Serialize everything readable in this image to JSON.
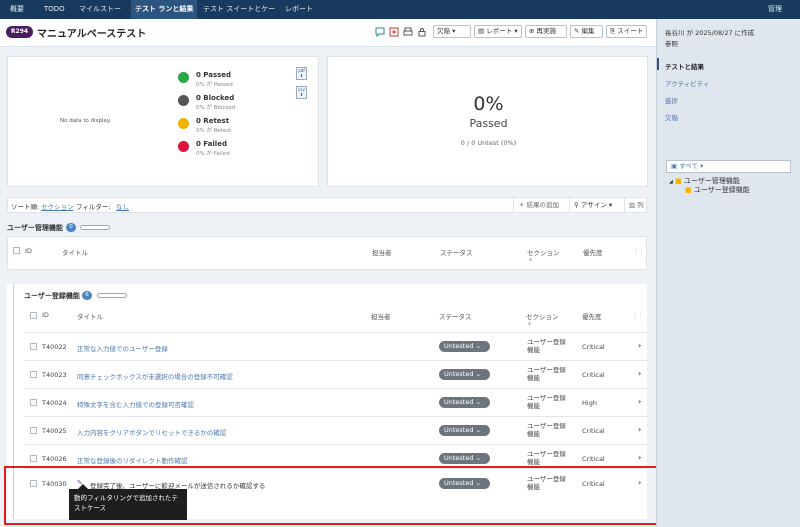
{
  "nav": {
    "tabs": [
      "概要",
      "TODO",
      "マイルストーン",
      "テスト ランと結果",
      "テスト スイートとケース",
      "レポート"
    ],
    "admin": "管理"
  },
  "header": {
    "badge": "R294",
    "title": "マニュアルベーステスト",
    "buttons": {
      "defects": "欠陥",
      "report": "レポート",
      "rerun": "再実施",
      "edit": "編集",
      "suite": "スイート"
    }
  },
  "summary": {
    "no_data": "No data to display.",
    "stats": [
      {
        "label": "0 Passed",
        "sub": "0% が Passed",
        "color": "#28a745"
      },
      {
        "label": "0 Blocked",
        "sub": "0% が Blocked",
        "color": "#555555"
      },
      {
        "label": "0 Retest",
        "sub": "0% が Retest",
        "color": "#f0b400"
      },
      {
        "label": "0 Failed",
        "sub": "0% が Failed",
        "color": "#dc143c"
      }
    ],
    "export_labels": [
      "pdf",
      "csv"
    ],
    "big_percent": "0%",
    "big_label": "Passed",
    "untest": "0 / 0 Untest (0%)"
  },
  "toolbar": {
    "sort_label": "ソート順:",
    "sort_value": "セクション",
    "filter_label": "フィルター:",
    "filter_value": "なし",
    "add_result": "結果の追加",
    "assign": "アサイン",
    "columns": "列"
  },
  "columns": {
    "id": "ID",
    "title": "タイトル",
    "assignee": "担当者",
    "status": "ステータス",
    "section": "セクション",
    "priority": "優先度"
  },
  "section1": {
    "name": "ユーザー管理機能",
    "count": "0"
  },
  "section2": {
    "name": "ユーザー登録機能",
    "count": "6",
    "rows": [
      {
        "id": "T40022",
        "title": "正常な入力値でのユーザー登録",
        "status": "Untested",
        "section": "ユーザー登録\n機能",
        "priority": "Critical"
      },
      {
        "id": "T40023",
        "title": "同意チェックボックスが未選択の場合の登録不可確認",
        "status": "Untested",
        "section": "ユーザー登録\n機能",
        "priority": "Critical"
      },
      {
        "id": "T40024",
        "title": "特殊文字を含む入力値での登録可否確認",
        "status": "Untested",
        "section": "ユーザー登録\n機能",
        "priority": "High"
      },
      {
        "id": "T40025",
        "title": "入力内容をクリアボタンでリセットできるかの確認",
        "status": "Untested",
        "section": "ユーザー登録\n機能",
        "priority": "Critical"
      },
      {
        "id": "T40026",
        "title": "正常な登録後のリダイレクト動作確認",
        "status": "Untested",
        "section": "ユーザー登録\n機能",
        "priority": "Critical"
      },
      {
        "id": "T40030",
        "title": "登録完了後、ユーザーに歓迎メールが送信されるか確認する",
        "status": "Untested",
        "section": "ユーザー登録\n機能",
        "priority": "Critical"
      }
    ]
  },
  "tooltip": "動的フィルタリングで追加されたテ\nストケース",
  "right_panel": {
    "created": "長谷川 が 2025/08/27 に作成",
    "ref": "参照",
    "links": [
      "テストと結果",
      "アクティビティ",
      "進捗",
      "欠陥"
    ],
    "tree_select": "すべて",
    "tree_root": "ユーザー管理機能",
    "tree_child": "ユーザー登録機能"
  },
  "colors": {
    "nav": "#173a5e",
    "highlight": "#e11d1d",
    "link": "#4a76b0"
  }
}
